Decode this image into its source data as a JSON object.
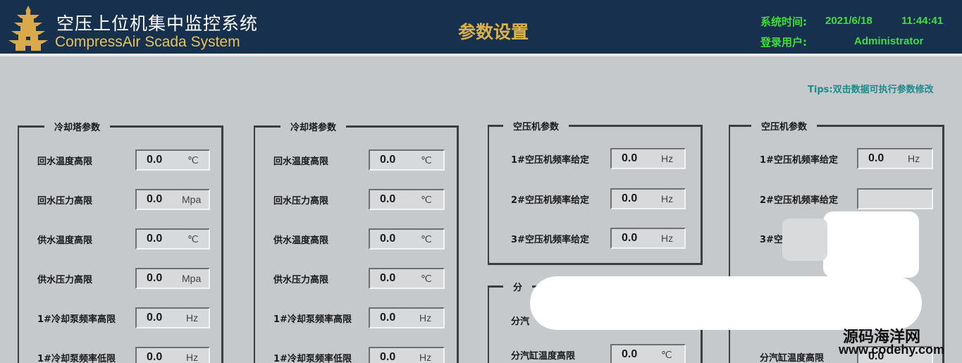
{
  "header": {
    "title_cn": "空压上位机集中监控系统",
    "title_en": "CompressAir Scada System",
    "page_title": "参数设置",
    "time_label": "系统时间:",
    "date": "2021/6/18",
    "time": "11:44:41",
    "user_label": "登录用户:",
    "user": "Administrator"
  },
  "tips": "Tips:双击数据可执行参数修改",
  "panels": [
    {
      "title": "冷却塔参数",
      "rows": [
        {
          "label": "回水温度高限",
          "value": "0.0",
          "unit": "℃"
        },
        {
          "label": "回水压力高限",
          "value": "0.0",
          "unit": "Mpa"
        },
        {
          "label": "供水温度高限",
          "value": "0.0",
          "unit": "℃"
        },
        {
          "label": "供水压力高限",
          "value": "0.0",
          "unit": "Mpa"
        },
        {
          "label": "1#冷却泵频率高限",
          "value": "0.0",
          "unit": "Hz"
        },
        {
          "label": "1#冷却泵频率低限",
          "value": "0.0",
          "unit": "Hz"
        }
      ]
    },
    {
      "title": "冷却塔参数",
      "rows": [
        {
          "label": "回水温度高限",
          "value": "0.0",
          "unit": "℃"
        },
        {
          "label": "回水压力高限",
          "value": "0.0",
          "unit": "℃"
        },
        {
          "label": "供水温度高限",
          "value": "0.0",
          "unit": "℃"
        },
        {
          "label": "供水压力高限",
          "value": "0.0",
          "unit": "℃"
        },
        {
          "label": "1#冷却泵频率高限",
          "value": "0.0",
          "unit": "Hz"
        },
        {
          "label": "1#冷却泵频率低限",
          "value": "0.0",
          "unit": "Hz"
        }
      ]
    },
    {
      "title": "空压机参数",
      "rows": [
        {
          "label": "1#空压机频率给定",
          "value": "0.0",
          "unit": "Hz"
        },
        {
          "label": "2#空压机频率给定",
          "value": "0.0",
          "unit": "Hz"
        },
        {
          "label": "3#空压机频率给定",
          "value": "0.0",
          "unit": "Hz"
        }
      ]
    },
    {
      "title": "空压机参数",
      "rows": [
        {
          "label": "1#空压机频率给定",
          "value": "0.0",
          "unit": "Hz"
        },
        {
          "label": "2#空压机频率给定"
        },
        {
          "label": "3#空"
        }
      ]
    },
    {
      "title": "分",
      "rows": [
        {
          "label": "分汽"
        },
        {
          "label": "分汽缸温度高限",
          "value": "0.0",
          "unit": "℃"
        }
      ]
    },
    {
      "rows": [
        {
          "label": "分汽缸温度高限",
          "value": "0.0"
        }
      ]
    }
  ],
  "watermark": {
    "line1": "源码海洋网",
    "line2": "www.codehy.com"
  }
}
